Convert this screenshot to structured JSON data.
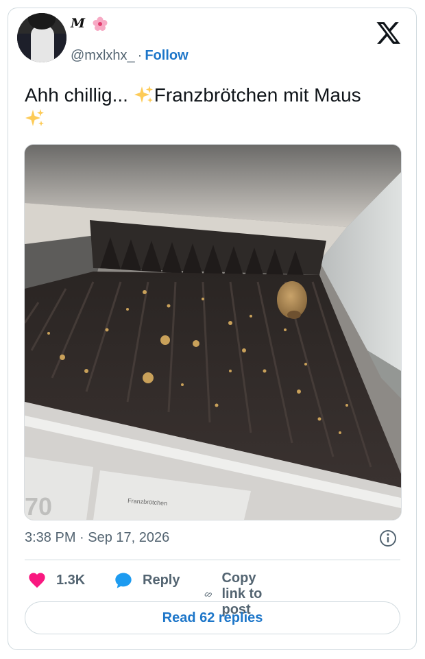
{
  "author": {
    "display_name": "M",
    "handle": "@mxlxhx_",
    "separator": "·",
    "follow_label": "Follow"
  },
  "tweet": {
    "text_part1": "Ahh chillig... ",
    "text_part2": "Franzbrötchen mit Maus",
    "timestamp": "3:38 PM · Sep 17, 2026"
  },
  "media": {
    "label_on_sign": "Franzbrötchen",
    "sign_digits": "70"
  },
  "actions": {
    "like_count": "1.3K",
    "reply_label": "Reply",
    "copy_label": "Copy link to post"
  },
  "footer": {
    "read_replies_label": "Read 62 replies"
  },
  "colors": {
    "accent": "#1d76c9",
    "like": "#f91880",
    "reply_bubble": "#1d9bf0",
    "muted": "#536471"
  },
  "icons": [
    "x-logo-icon",
    "flower-emoji-icon",
    "sparkle-emoji-icon",
    "info-icon",
    "heart-icon",
    "speech-bubble-icon",
    "link-icon"
  ]
}
